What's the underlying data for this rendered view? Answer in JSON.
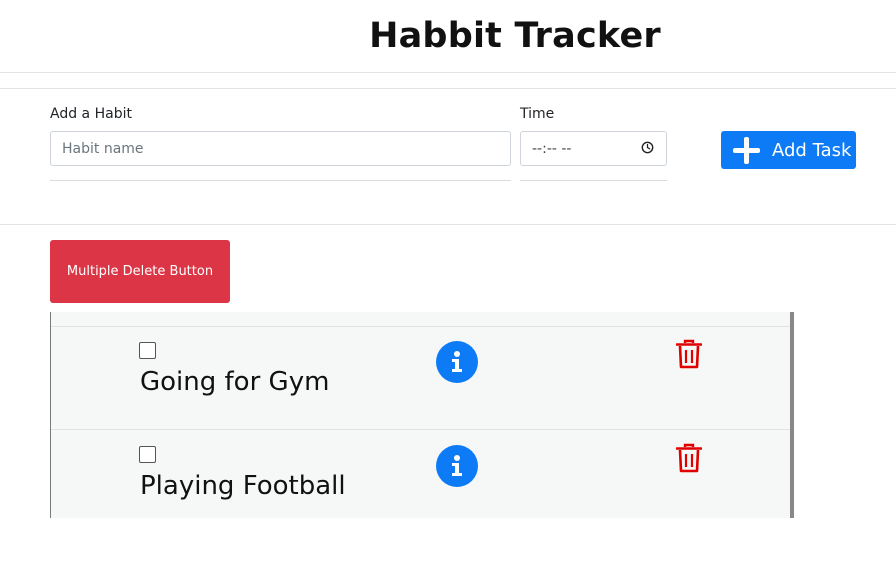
{
  "header": {
    "title": "Habbit Tracker"
  },
  "form": {
    "habit_label": "Add a Habit",
    "habit_placeholder": "Habit name",
    "time_label": "Time",
    "time_placeholder": "--:-- --",
    "add_button_label": "Add Task"
  },
  "actions": {
    "multi_delete_label": "Multiple Delete Button"
  },
  "habits": [
    {
      "name": "Going for Gym",
      "checked": false
    },
    {
      "name": "Playing Football",
      "checked": false
    }
  ],
  "icons": {
    "add": "plus-icon",
    "info": "info-icon",
    "delete": "trash-icon",
    "time": "clock-icon"
  },
  "colors": {
    "primary": "#0d7bf5",
    "danger": "#dc3545",
    "trash": "#e00000",
    "list_bg": "#f5f8f6"
  }
}
